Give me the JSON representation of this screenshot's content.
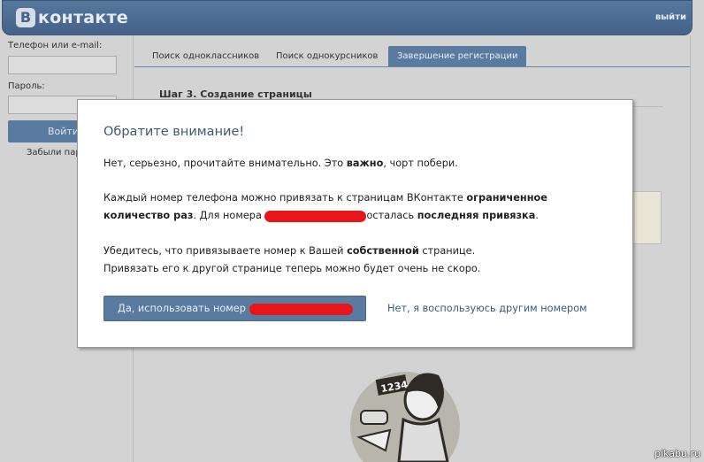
{
  "header": {
    "logo_letter": "B",
    "logo_text": "контакте",
    "logout": "выйти"
  },
  "login": {
    "phone_label": "Телефон или e-mail:",
    "password_label": "Пароль:",
    "login_button": "Войти",
    "forgot": "Забыли пароль?"
  },
  "tabs": [
    {
      "label": "Поиск одноклассников"
    },
    {
      "label": "Поиск однокурсников"
    },
    {
      "label": "Завершение регистрации",
      "active": true
    }
  ],
  "page": {
    "step_title": "Шаг 3. Создание страницы"
  },
  "modal": {
    "title": "Обратите внимание!",
    "line1_a": "Нет, серьезно, прочитайте внимательно. Это ",
    "line1_b": "важно",
    "line1_c": ", чорт побери.",
    "line2_a": "Каждый номер телефона можно привязать к страницам ВКонтакте ",
    "line2_b": "ограниченное",
    "line3_a": "количество раз",
    "line3_b": ". Для номера ",
    "line3_c": "осталась ",
    "line3_d": "последняя привязка",
    "line3_e": ".",
    "line4_a": "Убедитесь, что привязываете номер к Вашей ",
    "line4_b": "собственной",
    "line4_c": " странице.",
    "line5": "Привязать его к другой странице теперь можно будет очень не скоро.",
    "yes_button": "Да, использовать номер ",
    "no_link": "Нет, я воспользуюсь другим номером"
  },
  "illustration": {
    "sign_text": "1234"
  },
  "watermark": "pikabu.ru"
}
